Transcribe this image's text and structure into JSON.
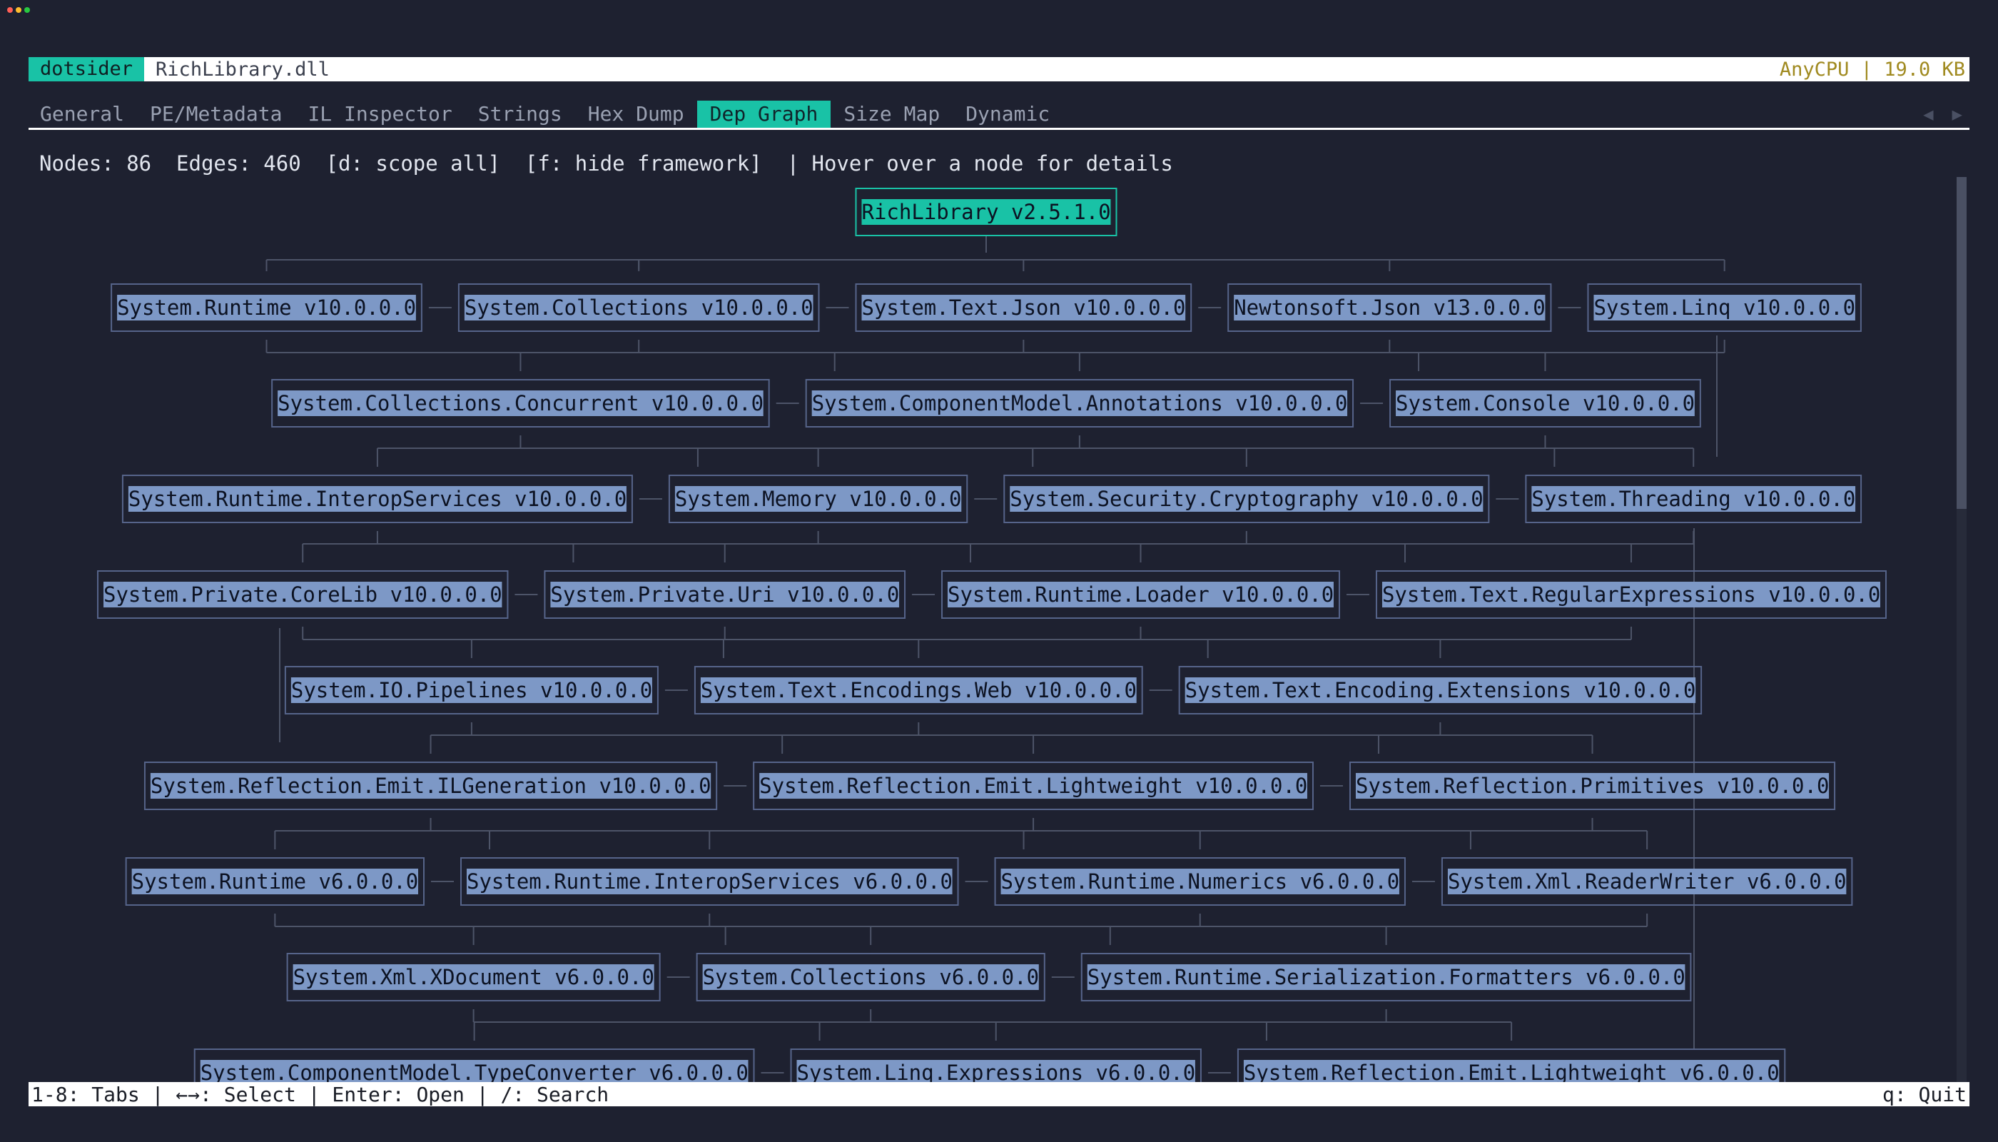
{
  "window": {
    "traffic_lights": [
      "#ff5f57",
      "#febc2e",
      "#28c840"
    ]
  },
  "titlebar": {
    "app": "dotsider",
    "file": "RichLibrary.dll",
    "right": "AnyCPU | 19.0 KB"
  },
  "tabs": [
    {
      "label": "General",
      "active": false
    },
    {
      "label": "PE/Metadata",
      "active": false
    },
    {
      "label": "IL Inspector",
      "active": false
    },
    {
      "label": "Strings",
      "active": false
    },
    {
      "label": "Hex Dump",
      "active": false
    },
    {
      "label": "Dep Graph",
      "active": true
    },
    {
      "label": "Size Map",
      "active": false
    },
    {
      "label": "Dynamic",
      "active": false
    }
  ],
  "tab_arrows": {
    "left": "◀",
    "right": "▶"
  },
  "info_line": "Nodes: 86  Edges: 460  [d: scope all]  [f: hide framework]  | Hover over a node for details",
  "graph": {
    "root": "RichLibrary v2.5.1.0",
    "rows": [
      [
        "System.Runtime v10.0.0.0",
        "System.Collections v10.0.0.0",
        "System.Text.Json v10.0.0.0",
        "Newtonsoft.Json v13.0.0.0",
        "System.Linq v10.0.0.0"
      ],
      [
        "System.Collections.Concurrent v10.0.0.0",
        "System.ComponentModel.Annotations v10.0.0.0",
        "System.Console v10.0.0.0"
      ],
      [
        "System.Runtime.InteropServices v10.0.0.0",
        "System.Memory v10.0.0.0",
        "System.Security.Cryptography v10.0.0.0",
        "System.Threading v10.0.0.0"
      ],
      [
        "System.Private.CoreLib v10.0.0.0",
        "System.Private.Uri v10.0.0.0",
        "System.Runtime.Loader v10.0.0.0",
        "System.Text.RegularExpressions v10.0.0.0"
      ],
      [
        "System.IO.Pipelines v10.0.0.0",
        "System.Text.Encodings.Web v10.0.0.0",
        "System.Text.Encoding.Extensions v10.0.0.0"
      ],
      [
        "System.Reflection.Emit.ILGeneration v10.0.0.0",
        "System.Reflection.Emit.Lightweight v10.0.0.0",
        "System.Reflection.Primitives v10.0.0.0"
      ],
      [
        "System.Runtime v6.0.0.0",
        "System.Runtime.InteropServices v6.0.0.0",
        "System.Runtime.Numerics v6.0.0.0",
        "System.Xml.ReaderWriter v6.0.0.0"
      ],
      [
        "System.Xml.XDocument v6.0.0.0",
        "System.Collections v6.0.0.0",
        "System.Runtime.Serialization.Formatters v6.0.0.0"
      ],
      [
        "System.ComponentModel.TypeConverter v6.0.0.0",
        "System.Linq.Expressions v6.0.0.0",
        "System.Reflection.Emit.Lightweight v6.0.0.0"
      ]
    ]
  },
  "statusbar": {
    "left": "1-8: Tabs | ←→: Select | Enter: Open | /: Search",
    "right": "q: Quit"
  }
}
